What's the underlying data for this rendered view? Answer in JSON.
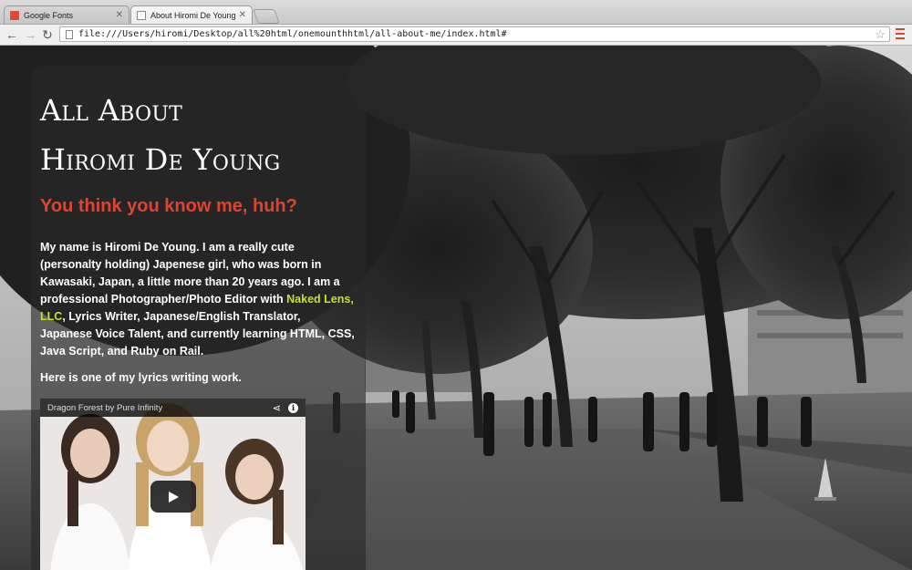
{
  "browser": {
    "tabs": [
      {
        "label": "Google Fonts",
        "icon": "google-fonts-favicon-icon"
      },
      {
        "label": "About Hiromi De Young",
        "icon": "document-favicon-icon"
      }
    ],
    "url": "file:///Users/hiromi/Desktop/all%20html/onemounthhtml/all-about-me/index.html#"
  },
  "page": {
    "heading_line1": "All About",
    "heading_line2": "Hiromi De Young",
    "subheading": "You think you know me, huh?",
    "bio_part1": "My name is Hiromi De Young. I am a really cute (personalty holding) Japenese girl, who was born in Kawasaki, Japan, a little more than 20 years ago. I am a professional Photographer/Photo Editor with ",
    "bio_link": "Naked Lens, LLC",
    "bio_part2": ", Lyrics Writer, Japanese/English Translator, Japanese Voice Talent, and currently learning HTML, CSS, Java Script, and Ruby on Rail.",
    "lyrics_intro": "Here is one of my lyrics writing work.",
    "video": {
      "title": "Dragon Forest by Pure Infinity"
    }
  },
  "colors": {
    "accent_red": "#e0432f",
    "link_green": "#c7e02e"
  }
}
